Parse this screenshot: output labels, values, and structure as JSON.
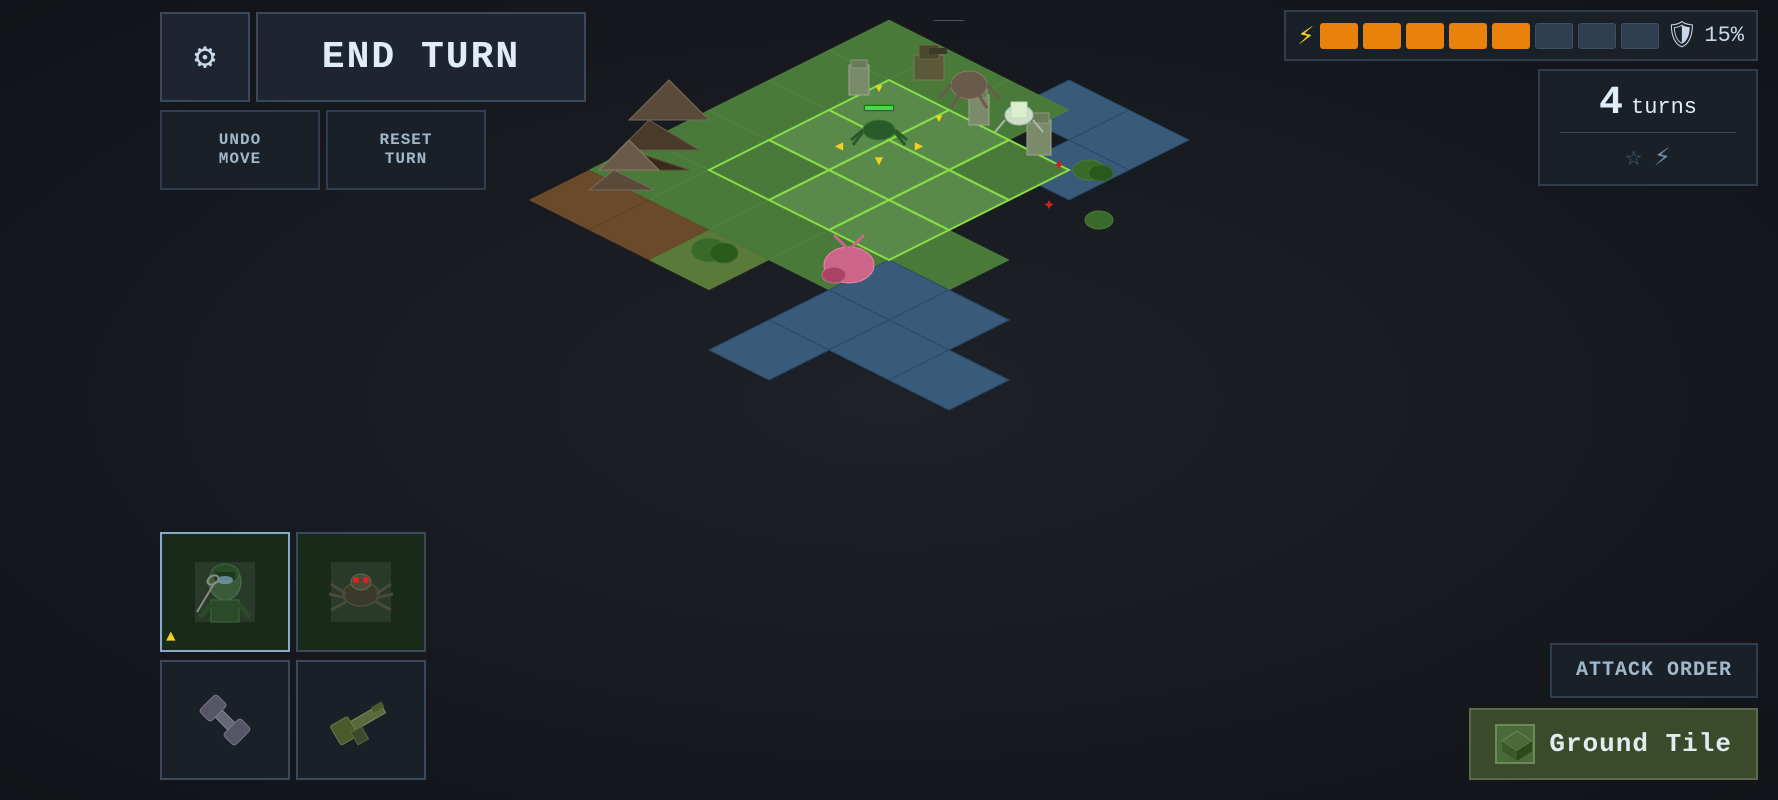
{
  "ui": {
    "end_turn_label": "End Turn",
    "gear_icon": "⚙",
    "undo_move_label": "UNDO\nMOVE",
    "reset_turn_label": "RESET\nTURN",
    "turns_count": "4",
    "turns_label": "turns",
    "shield_percent": "15%",
    "attack_order_label": "ATTACK\nORDER",
    "ground_tile_label": "Ground Tile"
  },
  "energy": {
    "filled_pips": 5,
    "empty_pips": 3,
    "total_pips": 8
  },
  "colors": {
    "bg_dark": "#111318",
    "panel_bg": "#1a2028",
    "border": "#2e3e50",
    "accent_orange": "#e8820a",
    "accent_yellow": "#f0d020",
    "text_light": "#e0ecf8",
    "text_muted": "#a0b8cc",
    "green_tile": "#3a6a2a",
    "ground_tile_bg": "#3a4a2a"
  }
}
